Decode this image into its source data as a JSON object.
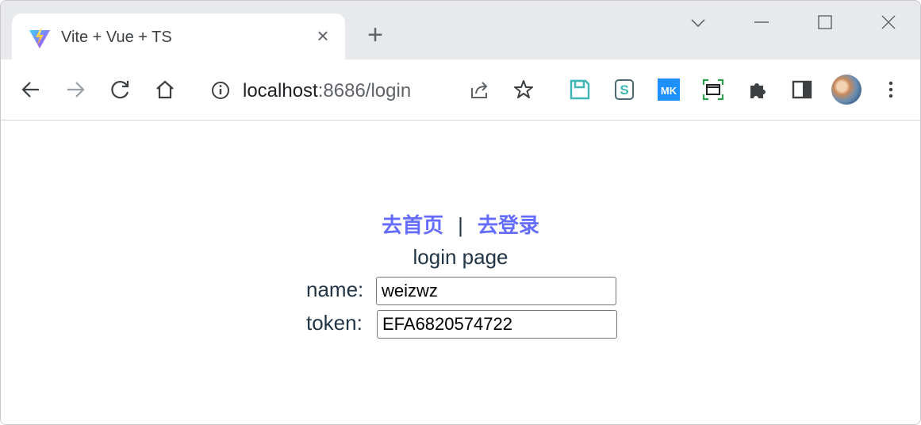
{
  "tab": {
    "title": "Vite + Vue + TS",
    "favicon": "vite-logo-icon",
    "close_icon": "close-icon"
  },
  "toolbar": {
    "url_host": "localhost",
    "url_path": ":8686/login",
    "extensions": [
      "save-extension-icon",
      "s-extension-icon",
      "mk-extension-icon",
      "screenshot-extension-icon",
      "puzzle-icon",
      "sidebar-icon"
    ]
  },
  "page": {
    "nav": {
      "home_link": "去首页",
      "separator": "|",
      "login_link": "去登录"
    },
    "title": "login page",
    "form": {
      "name_label": "name:",
      "name_value": "weizwz",
      "token_label": "token:",
      "token_value": "EFA6820574722"
    }
  },
  "colors": {
    "link": "#646cff",
    "text": "#213547",
    "tabstrip_bg": "#e8e9ec"
  }
}
